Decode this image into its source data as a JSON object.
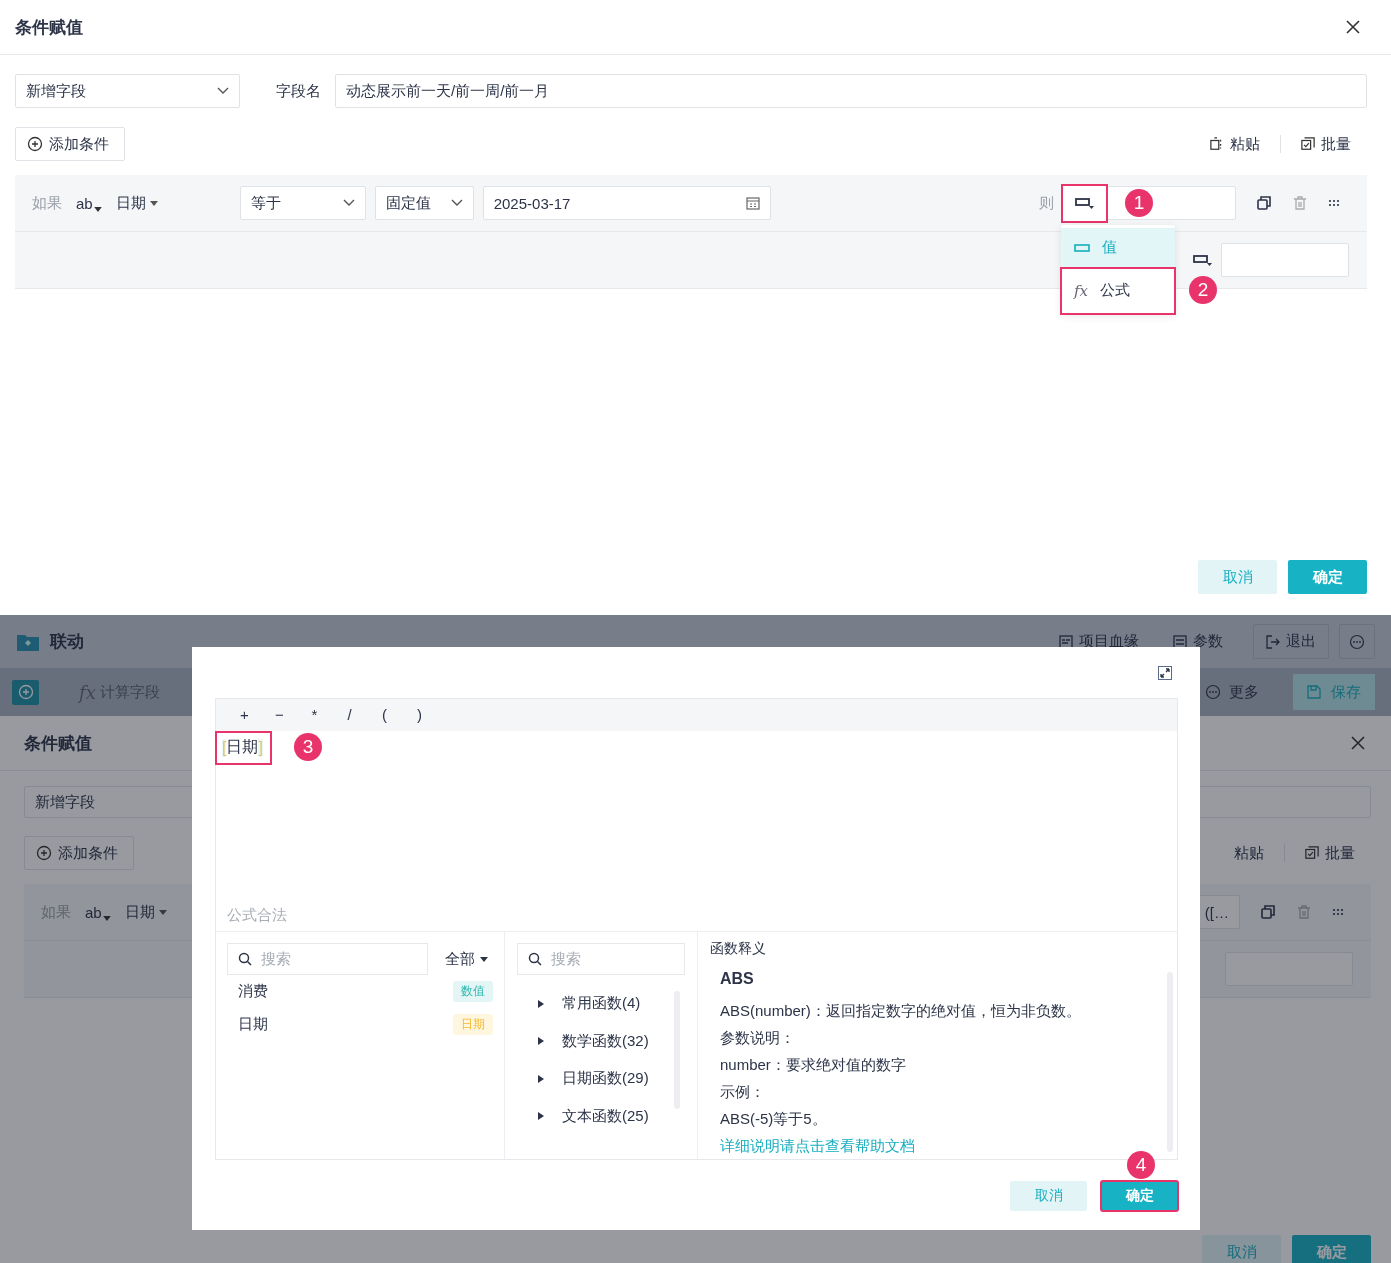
{
  "dialog": {
    "title": "条件赋值",
    "field_select": "新增字段",
    "field_name_label": "字段名",
    "field_name_value": "动态展示前一天/前一周/前一月",
    "add_condition": "添加条件",
    "paste": "粘贴",
    "batch": "批量",
    "condition": {
      "if_label": "如果",
      "field_type": "ab",
      "field": "日期",
      "operator": "等于",
      "value_mode": "固定值",
      "date": "2025-03-17",
      "then_label": "则",
      "value_type_callout": "1"
    },
    "value_type_menu": [
      {
        "label": "值",
        "kind": "value",
        "selected": true
      },
      {
        "label": "公式",
        "kind": "formula",
        "icon_text": "fx",
        "selected": false,
        "callout": "2"
      }
    ],
    "buttons": [
      {
        "label": "取消",
        "kind": "secondary"
      },
      {
        "label": "确定",
        "kind": "primary"
      }
    ]
  },
  "background_app": {
    "title": "联动",
    "header_actions": [
      {
        "label": "项目血缘",
        "kind": "lineage"
      },
      {
        "label": "参数",
        "kind": "params"
      },
      {
        "label": "退出",
        "kind": "exit"
      }
    ],
    "tab": {
      "icon_text": "fx",
      "label": "计算字段"
    },
    "more": "更多",
    "save": "保存",
    "dialog": {
      "title": "条件赋值",
      "field_select": "新增字段",
      "add_condition": "添加条件",
      "paste": "粘贴",
      "batch": "批量",
      "if_label": "如果",
      "field_type": "ab",
      "field": "日期",
      "then_value": "([…",
      "buttons": [
        {
          "label": "取消",
          "kind": "secondary"
        },
        {
          "label": "确定",
          "kind": "primary"
        }
      ]
    }
  },
  "formula_modal": {
    "operators": [
      "+",
      "−",
      "*",
      "/",
      "(",
      ")"
    ],
    "token": {
      "open": "[",
      "text": "日期",
      "close": "]",
      "callout": "3"
    },
    "status": "公式合法",
    "field_search_placeholder": "搜索",
    "field_filter": "全部",
    "fields": [
      {
        "name": "消费",
        "type": "数值",
        "kind": "number"
      },
      {
        "name": "日期",
        "type": "日期",
        "kind": "date"
      }
    ],
    "function_search_placeholder": "搜索",
    "function_groups": [
      "常用函数(4)",
      "数学函数(32)",
      "日期函数(29)",
      "文本函数(25)"
    ],
    "doc": {
      "heading": "函数释义",
      "name": "ABS",
      "lines": [
        "ABS(number)：返回指定数字的绝对值，恒为非负数。",
        "参数说明：",
        "number：要求绝对值的数字",
        "示例：",
        "ABS(-5)等于5。"
      ],
      "link": "详细说明请点击查看帮助文档"
    },
    "buttons": [
      {
        "label": "取消",
        "kind": "secondary"
      },
      {
        "label": "确定",
        "kind": "primary",
        "callout": "4"
      }
    ]
  }
}
